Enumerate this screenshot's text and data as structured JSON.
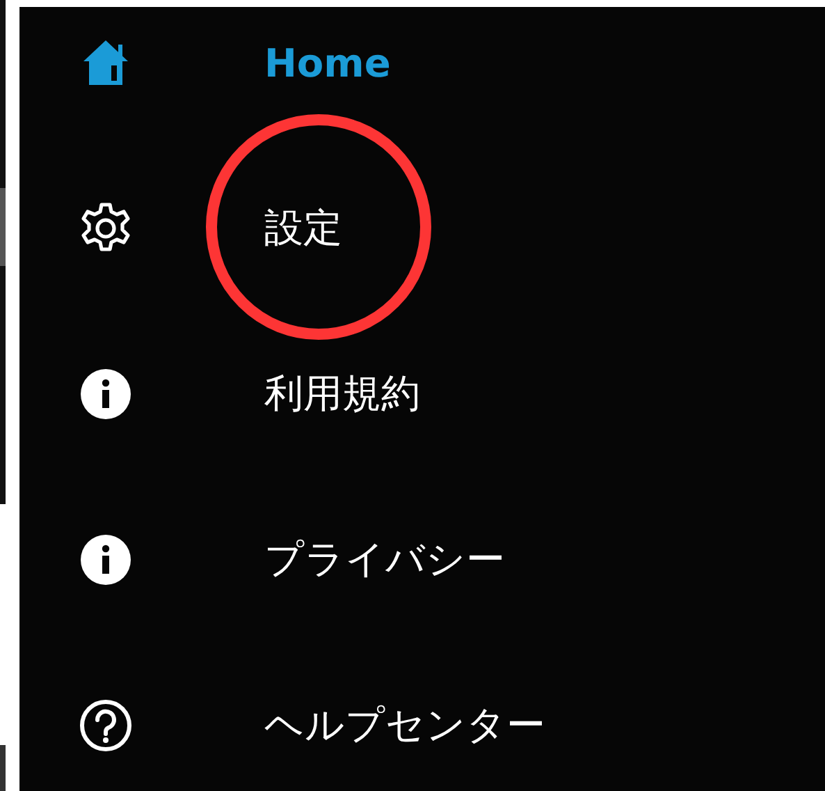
{
  "menu": {
    "items": [
      {
        "kind": "home",
        "label": "Home",
        "selected": true,
        "circled": false
      },
      {
        "kind": "gear",
        "label": "設定",
        "selected": false,
        "circled": true
      },
      {
        "kind": "info",
        "label": "利用規約",
        "selected": false,
        "circled": false
      },
      {
        "kind": "info",
        "label": "プライバシー",
        "selected": false,
        "circled": false
      },
      {
        "kind": "help",
        "label": "ヘルプセンター",
        "selected": false,
        "circled": false
      }
    ]
  }
}
